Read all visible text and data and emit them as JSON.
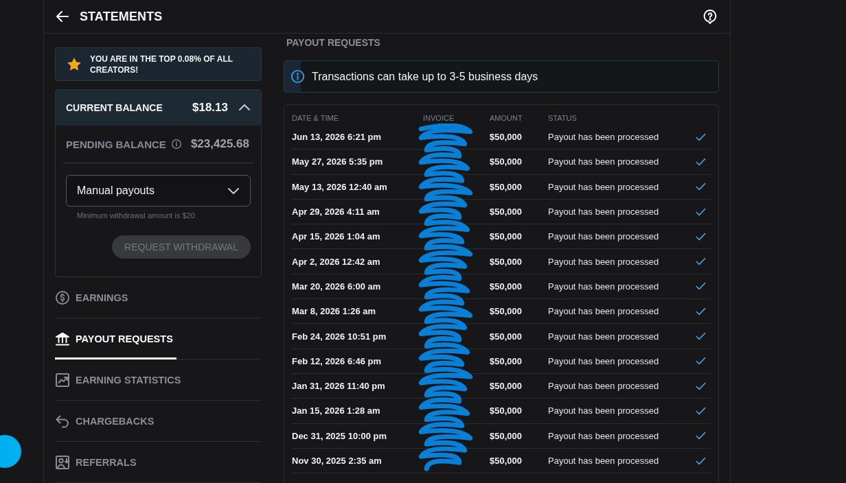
{
  "header": {
    "title": "STATEMENTS"
  },
  "rank_banner": {
    "text": "YOU ARE IN THE TOP 0.08% OF ALL CREATORS!"
  },
  "balance_card": {
    "title": "CURRENT BALANCE",
    "amount": "$18.13",
    "expanded": true,
    "pending": {
      "label": "PENDING BALANCE",
      "amount": "$23,425.68"
    },
    "payout_select": {
      "value": "Manual payouts",
      "hint": "Minimum withdrawal amount is $20"
    },
    "withdraw_button": {
      "label": "REQUEST WITHDRAWAL",
      "disabled": true
    }
  },
  "sidebar": {
    "items": [
      {
        "label": "EARNINGS",
        "selected": false
      },
      {
        "label": "PAYOUT REQUESTS",
        "selected": true
      },
      {
        "label": "EARNING STATISTICS",
        "selected": false
      },
      {
        "label": "CHARGEBACKS",
        "selected": false
      },
      {
        "label": "REFERRALS",
        "selected": false
      }
    ]
  },
  "section_title": "PAYOUT REQUESTS",
  "notice": {
    "text": "Transactions can take up to 3-5 business days"
  },
  "table": {
    "columns": [
      "DATE & TIME",
      "INVOICE",
      "AMOUNT",
      "STATUS"
    ],
    "rows": [
      {
        "date_time": "Jun 13, 2026 6:21 pm",
        "amount": "$50,000",
        "status": "Payout has been processed"
      },
      {
        "date_time": "May 27, 2026 5:35 pm",
        "amount": "$50,000",
        "status": "Payout has been processed"
      },
      {
        "date_time": "May 13, 2026 12:40 am",
        "amount": "$50,000",
        "status": "Payout has been processed"
      },
      {
        "date_time": "Apr 29, 2026 4:11 am",
        "amount": "$50,000",
        "status": "Payout has been processed"
      },
      {
        "date_time": "Apr 15, 2026 1:04 am",
        "amount": "$50,000",
        "status": "Payout has been processed"
      },
      {
        "date_time": "Apr 2, 2026 12:42 am",
        "amount": "$50,000",
        "status": "Payout has been processed"
      },
      {
        "date_time": "Mar 20, 2026 6:00 am",
        "amount": "$50,000",
        "status": "Payout has been processed"
      },
      {
        "date_time": "Mar 8, 2026 1:26 am",
        "amount": "$50,000",
        "status": "Payout has been processed"
      },
      {
        "date_time": "Feb 24, 2026 10:51 pm",
        "amount": "$50,000",
        "status": "Payout has been processed"
      },
      {
        "date_time": "Feb 12, 2026 6:46 pm",
        "amount": "$50,000",
        "status": "Payout has been processed"
      },
      {
        "date_time": "Jan 31, 2026 11:40 pm",
        "amount": "$50,000",
        "status": "Payout has been processed"
      },
      {
        "date_time": "Jan 15, 2026 1:28 am",
        "amount": "$50,000",
        "status": "Payout has been processed"
      },
      {
        "date_time": "Dec 31, 2025 10:00 pm",
        "amount": "$50,000",
        "status": "Payout has been processed"
      },
      {
        "date_time": "Nov 30, 2025 2:35 am",
        "amount": "$50,000",
        "status": "Payout has been processed"
      }
    ]
  }
}
